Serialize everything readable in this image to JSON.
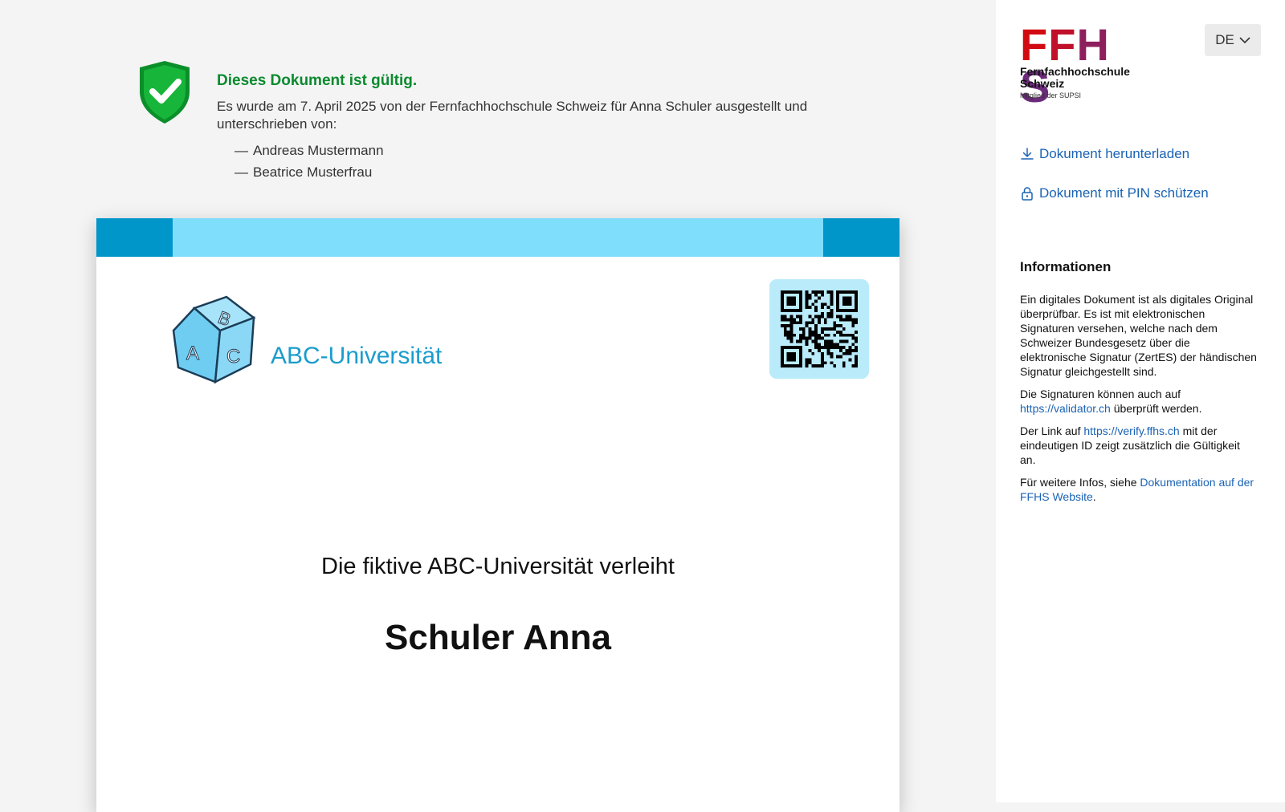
{
  "validity": {
    "title": "Dieses Dokument ist gültig.",
    "description": "Es wurde am 7. April 2025 von der Fernfachhochschule Schweiz für Anna Schuler ausgestellt und unterschrieben von:",
    "signers": [
      "Andreas Mustermann",
      "Beatrice Musterfrau"
    ],
    "dash": "—",
    "status_color": "#0b8a2e"
  },
  "document": {
    "university_name": "ABC-Universität",
    "line1": "Die fiktive ABC-Universität verleiht",
    "recipient": "Schuler Anna",
    "band_color": "#7fdefc",
    "band_accent_color": "#0096c9",
    "logo_letters": [
      "A",
      "B",
      "C"
    ]
  },
  "sidebar": {
    "logo": {
      "letters": [
        "F",
        "F",
        "H",
        "S"
      ],
      "letter_colors": [
        "#d20a11",
        "#c0102a",
        "#8e1f5d",
        "#6b2a7a"
      ],
      "name_line1": "Fernfachhochschule",
      "name_line2": "Schweiz",
      "subtitle": "Mitglied der SUPSI"
    },
    "language": "DE",
    "actions": {
      "download": "Dokument herunterladen",
      "pin": "Dokument mit PIN schützen"
    },
    "info": {
      "title": "Informationen",
      "p1": "Ein digitales Dokument ist als digitales Original überprüfbar. Es ist mit elektronischen Signaturen versehen, welche nach dem Schweizer Bundesgesetz über die elektronische Signatur (ZertES) der händischen Signatur gleichgestellt sind.",
      "p2_before": "Die Signaturen können auch auf ",
      "p2_link": "https://validator.ch",
      "p2_after": " überprüft werden.",
      "p3_before": "Der Link auf ",
      "p3_link": "https://verify.ffhs.ch",
      "p3_after": " mit der eindeutigen ID zeigt zusätzlich die Gültigkeit an.",
      "p4_before": "Für weitere Infos, siehe ",
      "p4_link": "Dokumentation auf der FFHS Website",
      "p4_after": "."
    },
    "link_color": "#1a63b5"
  }
}
